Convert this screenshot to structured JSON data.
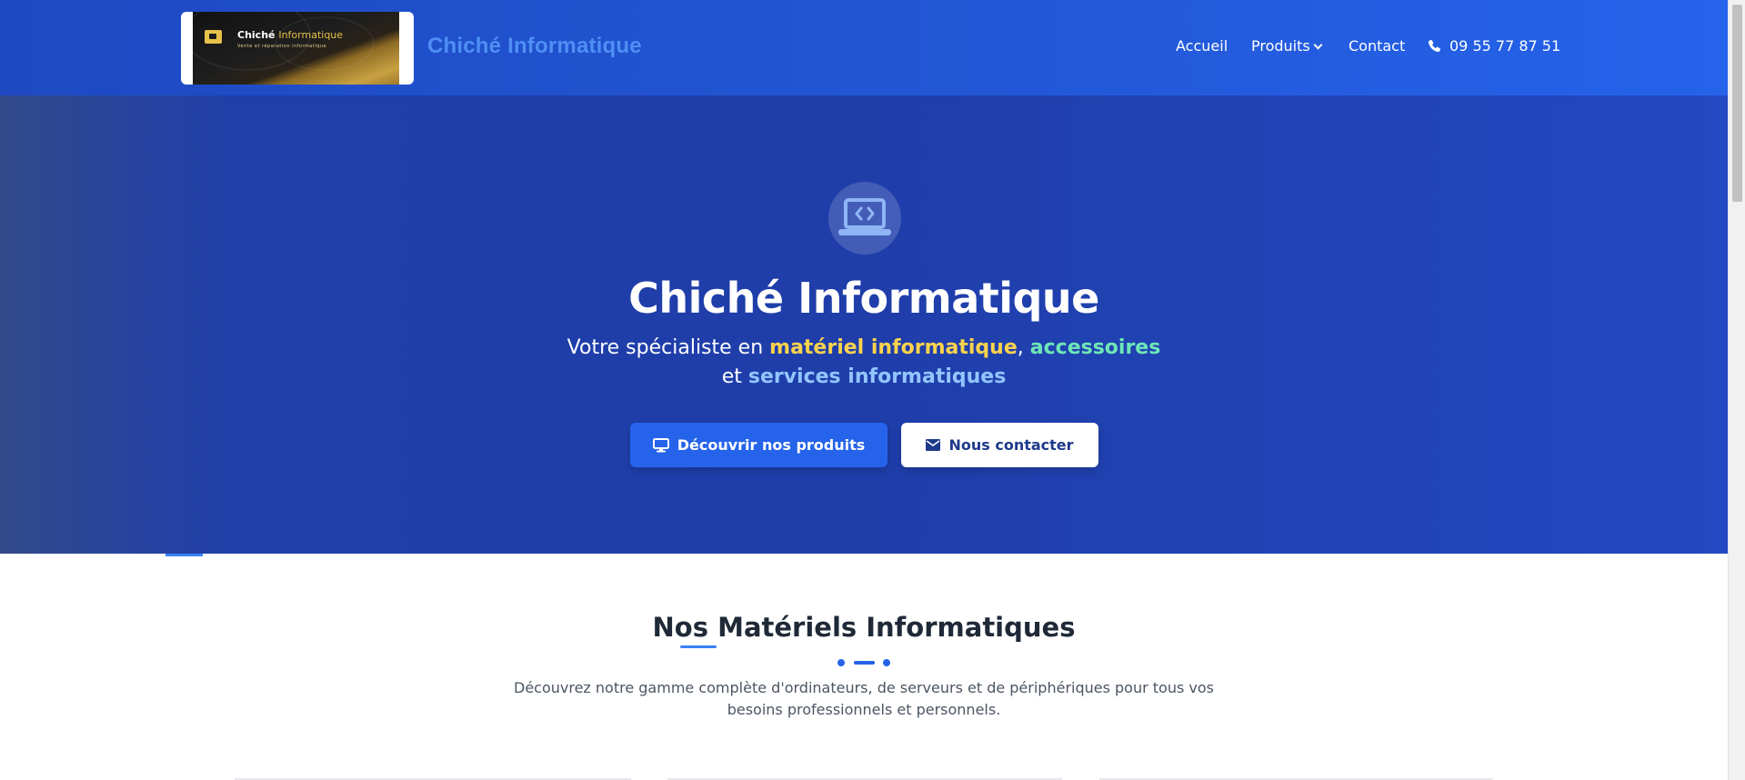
{
  "header": {
    "logo": {
      "title_main": "Chiché",
      "title_accent": "Informatique",
      "subtitle": "Vente et réparation informatique"
    },
    "brand_name": "Chiché Informatique",
    "nav": {
      "accueil": "Accueil",
      "produits": "Produits",
      "contact": "Contact",
      "phone": "09 55 77 87 51"
    }
  },
  "hero": {
    "icon": "laptop-code-icon",
    "title": "Chiché Informatique",
    "subtitle": {
      "prefix": "Votre spécialiste en ",
      "highlight_1": "matériel informatique",
      "sep": ", ",
      "highlight_2": "accessoires",
      "middle": " et ",
      "highlight_3": "services informatiques"
    },
    "buttons": {
      "primary": "Découvrir nos produits",
      "secondary": "Nous contacter"
    }
  },
  "section": {
    "title": "Nos Matériels Informatiques",
    "description": "Découvrez notre gamme complète d'ordinateurs, de serveurs et de périphériques pour tous vos besoins professionnels et personnels."
  },
  "colors": {
    "header_bg": "#2257d6",
    "hero_bg": "#1f3eaa",
    "accent_blue": "#2563eb",
    "highlight_yellow": "#fcd34d",
    "highlight_green": "#6ee7b7",
    "highlight_light_blue": "#93c5fd"
  }
}
